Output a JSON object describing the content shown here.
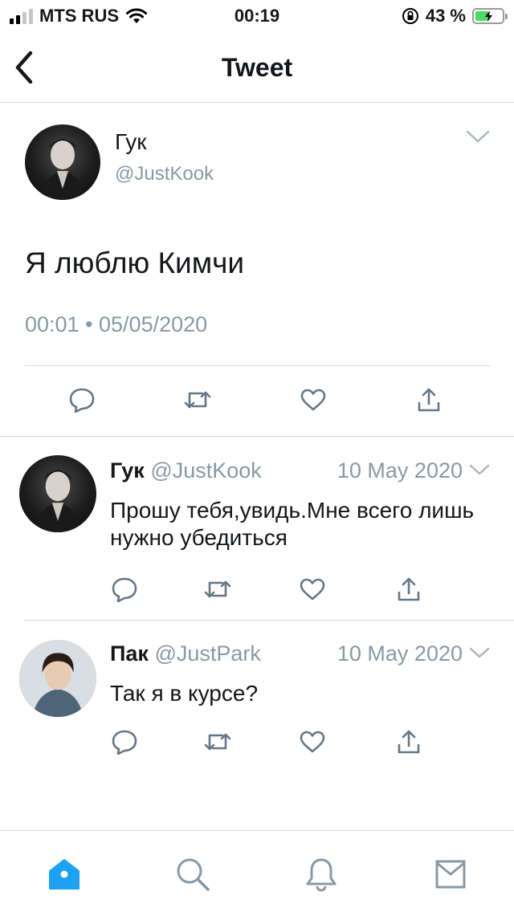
{
  "status_bar": {
    "carrier": "MTS RUS",
    "time": "00:19",
    "battery_percent": "43 %",
    "battery_level": 0.43
  },
  "nav": {
    "title": "Tweet",
    "back_icon": "chevron-left-icon"
  },
  "main_tweet": {
    "name": "Гук",
    "handle": "@JustKook",
    "text": "Я люблю Кимчи",
    "meta": "00:01 • 05/05/2020",
    "actions": [
      "reply-icon",
      "retweet-icon",
      "like-icon",
      "share-icon"
    ]
  },
  "replies": [
    {
      "name": "Гук",
      "handle": "@JustKook",
      "date": "10 May 2020",
      "text": "Прошу тебя,увидь.Мне всего лишь нужно убедиться"
    },
    {
      "name": "Пак",
      "handle": "@JustPark",
      "date": "10 May 2020",
      "text": "Так я в курсе?"
    }
  ],
  "tabbar": {
    "tabs": [
      "home-icon",
      "search-icon",
      "notifications-icon",
      "messages-icon"
    ],
    "accent": "#1da1f2"
  },
  "colors": {
    "secondary_text": "#8899a6",
    "icon": "#657786",
    "divider": "#d4d8dc"
  }
}
